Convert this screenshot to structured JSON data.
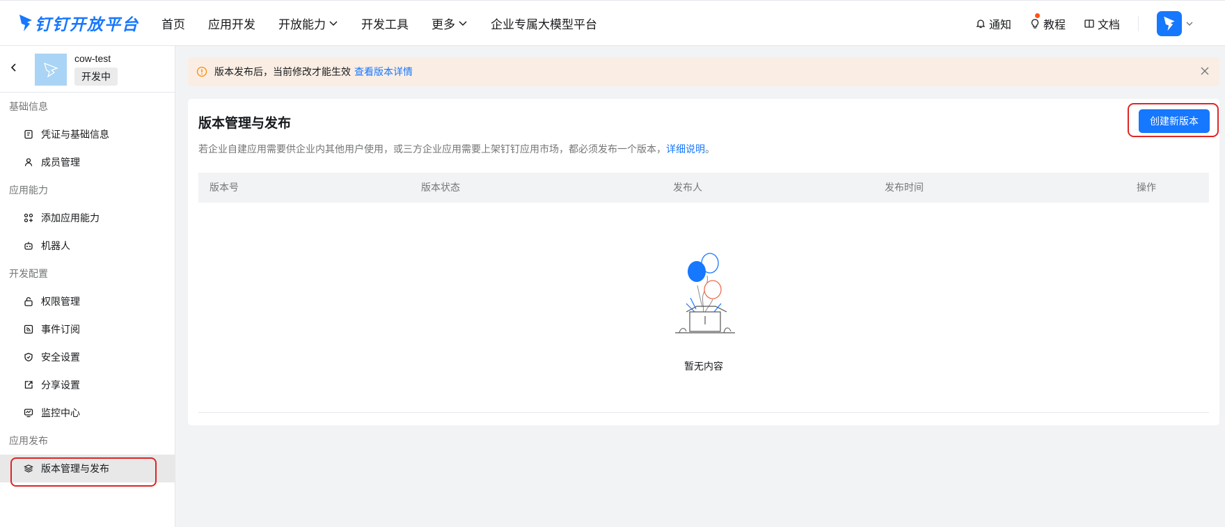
{
  "header": {
    "logo_text": "钉钉开放平台",
    "nav": [
      {
        "label": "首页",
        "dropdown": false
      },
      {
        "label": "应用开发",
        "dropdown": false
      },
      {
        "label": "开放能力",
        "dropdown": true
      },
      {
        "label": "开发工具",
        "dropdown": false
      },
      {
        "label": "更多",
        "dropdown": true
      },
      {
        "label": "企业专属大模型平台",
        "dropdown": false
      }
    ],
    "right": {
      "notice": "通知",
      "tutorial": "教程",
      "docs": "文档"
    }
  },
  "sidebar": {
    "app_name": "cow-test",
    "app_status": "开发中",
    "sections": [
      {
        "title": "基础信息",
        "items": [
          {
            "label": "凭证与基础信息",
            "icon": "credential-icon"
          },
          {
            "label": "成员管理",
            "icon": "user-icon"
          }
        ]
      },
      {
        "title": "应用能力",
        "items": [
          {
            "label": "添加应用能力",
            "icon": "grid-add-icon"
          },
          {
            "label": "机器人",
            "icon": "robot-icon"
          }
        ]
      },
      {
        "title": "开发配置",
        "items": [
          {
            "label": "权限管理",
            "icon": "lock-icon"
          },
          {
            "label": "事件订阅",
            "icon": "rss-icon"
          },
          {
            "label": "安全设置",
            "icon": "shield-icon"
          },
          {
            "label": "分享设置",
            "icon": "share-icon"
          },
          {
            "label": "监控中心",
            "icon": "monitor-icon"
          }
        ]
      },
      {
        "title": "应用发布",
        "items": [
          {
            "label": "版本管理与发布",
            "icon": "layers-icon",
            "active": true
          }
        ]
      }
    ]
  },
  "banner": {
    "text": "版本发布后，当前修改才能生效",
    "link": "查看版本详情"
  },
  "main": {
    "title": "版本管理与发布",
    "desc": "若企业自建应用需要供企业内其他用户使用，或三方企业应用需要上架钉钉应用市场，都必须发布一个版本，",
    "desc_link": "详细说明",
    "desc_end": "。",
    "create_button": "创建新版本",
    "columns": [
      "版本号",
      "版本状态",
      "发布人",
      "发布时间",
      "操作"
    ],
    "empty_text": "暂无内容"
  },
  "colors": {
    "accent": "#1677ff",
    "highlight": "#e02424",
    "banner_bg": "#faeee4"
  }
}
